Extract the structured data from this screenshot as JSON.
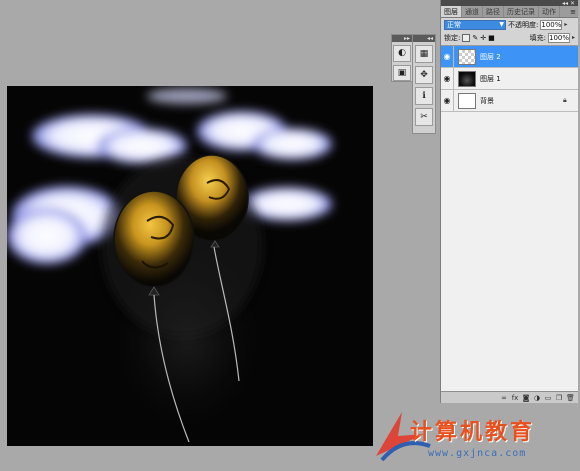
{
  "layers_panel": {
    "tabs": [
      "图层",
      "通道",
      "路径",
      "历史记录",
      "动作"
    ],
    "active_tab": 0,
    "blend_mode": "正常",
    "opacity_label": "不透明度:",
    "opacity_value": "100%",
    "lock_label": "锁定:",
    "fill_label": "填充:",
    "fill_value": "100%",
    "layers": [
      {
        "name": "图层 2",
        "thumb": "transparent",
        "selected": true,
        "locked": false
      },
      {
        "name": "图层 1",
        "thumb": "dark",
        "selected": false,
        "locked": false
      },
      {
        "name": "背景",
        "thumb": "white",
        "selected": false,
        "locked": true
      }
    ],
    "footer_icons": [
      "link-icon",
      "fx-icon",
      "mask-icon",
      "adjustment-icon",
      "group-icon",
      "new-layer-icon",
      "trash-icon"
    ]
  },
  "toolbars": {
    "left_strip_icons": [
      "brush-preset-icon",
      "clone-source-icon"
    ],
    "right_strip_icons": [
      "histogram-icon",
      "navigator-icon",
      "info-icon",
      "tool-preset-icon"
    ]
  },
  "watermark": {
    "text": "计算机教育",
    "url": "www.gxjnca.com"
  },
  "colors": {
    "accent": "#3d94f6",
    "canvas": "#060606",
    "workspace": "#a9a9a9",
    "balloon": "#c8951e",
    "cloud": "#eef0ff"
  }
}
